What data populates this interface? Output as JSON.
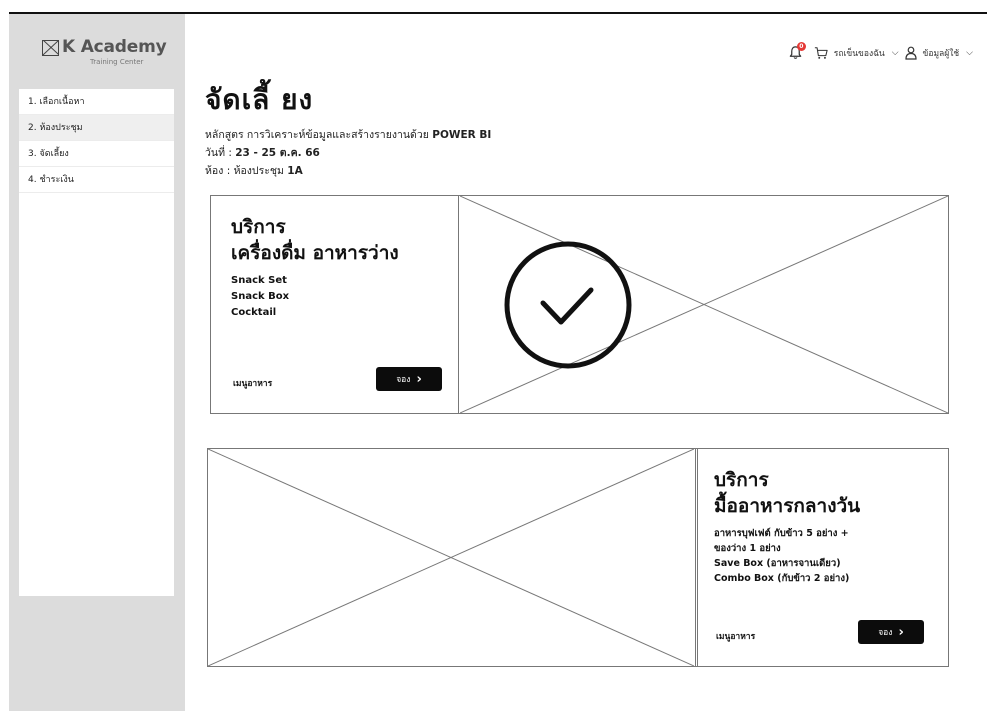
{
  "brand": {
    "name": "K Academy",
    "subtitle": "Training Center"
  },
  "sidebar": {
    "items": [
      {
        "label": "1. เลือกเนื้อหา"
      },
      {
        "label": "2. ห้องประชุม"
      },
      {
        "label": "3. จัดเลี้ยง"
      },
      {
        "label": "4. ชำระเงิน"
      }
    ]
  },
  "topbar": {
    "notification_count": "0",
    "cart_label": "รถเข็นของฉัน",
    "user_label": "ข้อมูลผู้ใช้"
  },
  "page": {
    "title": "จัดเลี้ ยง",
    "course_prefix": "หลักสูตร การวิเคราะห์ข้อมูลและสร้างรายงานด้วย ",
    "course_name": "POWER BI",
    "date_prefix": "วันที่ : ",
    "date_value": "23 - 25 ต.ค. 66",
    "room_prefix": "ห้อง : ห้องประชุม ",
    "room_value": "1A"
  },
  "services": [
    {
      "title_line1": "บริการ",
      "title_line2": "เครื่องดื่ม อาหารว่าง",
      "items": [
        "Snack Set",
        "Snack Box",
        "Cocktail"
      ],
      "menu_link": "เมนูอาหาร",
      "book_label": "จอง",
      "selected": true
    },
    {
      "title_line1": "บริการ",
      "title_line2": "มื้ออาหารกลางวัน",
      "items": [
        "อาหารบุฟเฟต์ กับข้าว 5 อย่าง +",
        "ของว่าง 1 อย่าง",
        "Save Box (อาหารจานเดียว)",
        "Combo Box (กับข้าว 2 อย่าง)"
      ],
      "menu_link": "เมนูอาหาร",
      "book_label": "จอง",
      "selected": false
    }
  ],
  "icons": {
    "bell": "bell-icon",
    "cart": "cart-icon",
    "user": "user-icon",
    "check": "check-circle-icon",
    "placeholder": "image-placeholder-icon"
  }
}
